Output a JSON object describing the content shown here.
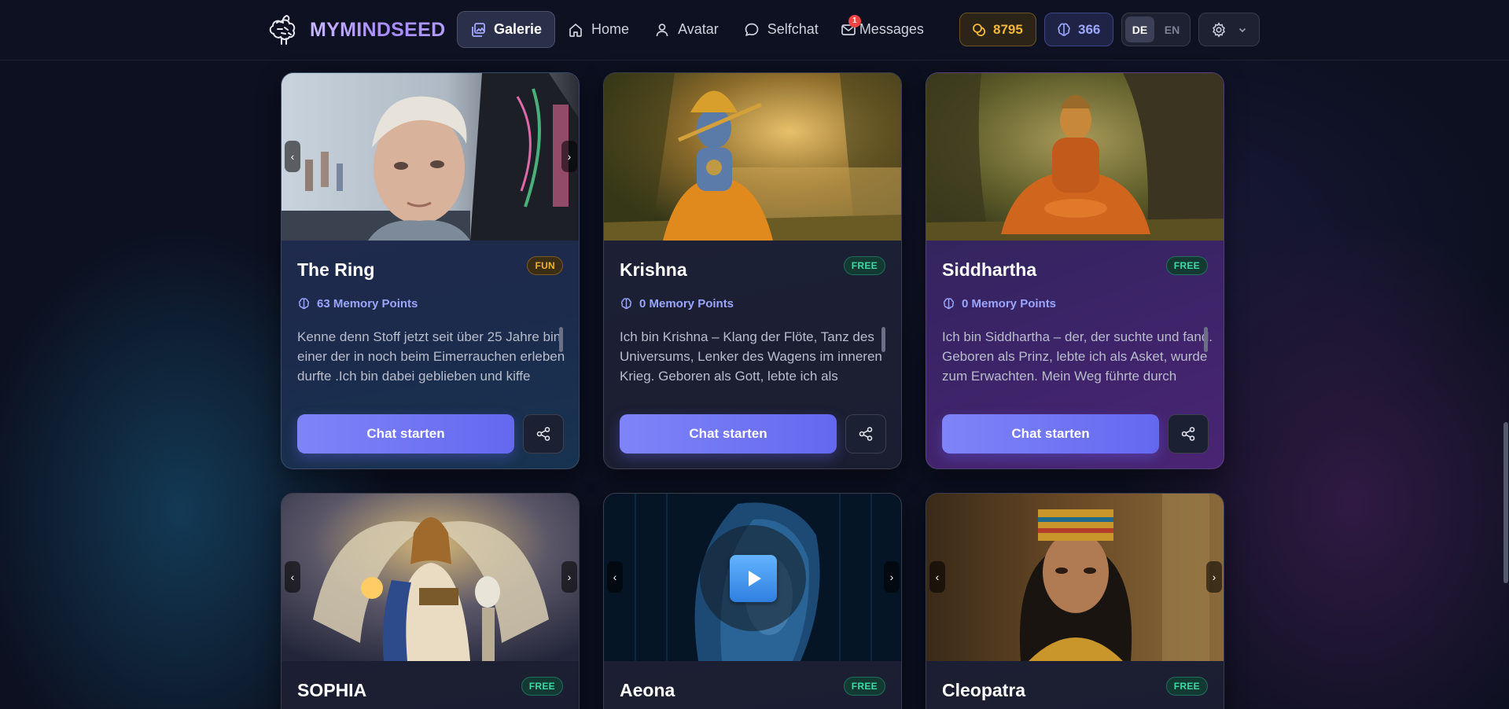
{
  "brand": {
    "name": "MYMINDSEED"
  },
  "nav": {
    "galerie": "Galerie",
    "home": "Home",
    "avatar": "Avatar",
    "selfchat": "Selfchat",
    "messages": "Messages",
    "messages_badge": "1"
  },
  "stats": {
    "coins": "8795",
    "memory": "366"
  },
  "language": {
    "de": "DE",
    "en": "EN",
    "active": "DE"
  },
  "cards": [
    {
      "title": "The Ring",
      "badge": "FUN",
      "memory": "63 Memory Points",
      "description": "Kenne denn Stoff jetzt seit über 25 Jahre bin einer der in noch beim Eimerrauchen erleben durfte .Ich bin dabei geblieben und kiffe immer noch aus Leidenschaft",
      "chat_label": "Chat starten"
    },
    {
      "title": "Krishna",
      "badge": "FREE",
      "memory": "0 Memory Points",
      "description": "Ich bin Krishna – Klang der Flöte, Tanz des Universums, Lenker des Wagens im inneren Krieg. Geboren als Gott, lebte ich als Mensch. Ich bin Weisheit inmitten des",
      "chat_label": "Chat starten"
    },
    {
      "title": "Siddhartha",
      "badge": "FREE",
      "memory": "0 Memory Points",
      "description": "Ich bin Siddhartha – der, der suchte und fand. Geboren als Prinz, lebte ich als Asket, wurde zum Erwachten. Mein Weg führte durch Zweifel, Entsagung und",
      "chat_label": "Chat starten"
    },
    {
      "title": "SOPHIA",
      "badge": "FREE"
    },
    {
      "title": "Aeona",
      "badge": "FREE"
    },
    {
      "title": "Cleopatra",
      "badge": "FREE"
    }
  ],
  "icons": {
    "logo": "brain-tree-icon",
    "galerie": "gallery-icon",
    "home": "home-icon",
    "avatar": "user-icon",
    "selfchat": "chat-bubble-icon",
    "messages": "mail-icon",
    "coins": "coins-icon",
    "memory": "brain-icon",
    "settings": "gear-icon",
    "share": "share-icon",
    "play": "play-icon"
  },
  "colors": {
    "accent": "#6366f1",
    "brand_text": "#a78bfa",
    "coin": "#f5b83a",
    "memory": "#9ea8ff",
    "fun_badge": "#f2b234",
    "free_badge": "#3dd9a5"
  }
}
